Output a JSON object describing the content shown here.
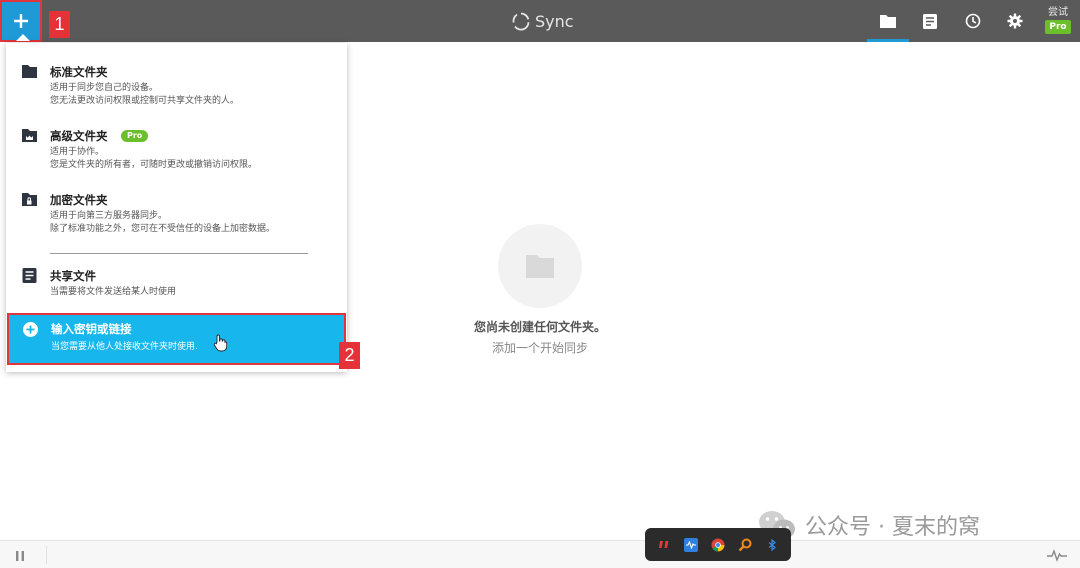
{
  "topbar": {
    "add_callout": "1",
    "brand": "Sync",
    "tools": [
      {
        "icon": "folder-icon",
        "active": true
      },
      {
        "icon": "document-icon",
        "active": false
      },
      {
        "icon": "history-icon",
        "active": false
      },
      {
        "icon": "gear-icon",
        "active": false
      }
    ],
    "try_label": "尝试",
    "pro_label": "Pro"
  },
  "menu": {
    "items": [
      {
        "icon": "folder-icon",
        "title": "标准文件夹",
        "desc1": "适用于同步您自己的设备。",
        "desc2": "您无法更改访问权限或控制可共享文件夹的人。"
      },
      {
        "icon": "advanced-folder-icon",
        "title": "高级文件夹",
        "badge": "Pro",
        "desc1": "适用于协作。",
        "desc2": "您是文件夹的所有者，可随时更改或撤销访问权限。"
      },
      {
        "icon": "encrypted-folder-icon",
        "title": "加密文件夹",
        "desc1": "适用于向第三方服务器同步。",
        "desc2": "除了标准功能之外，您可在不受信任的设备上加密数据。"
      },
      {
        "icon": "share-file-icon",
        "title": "共享文件",
        "desc1": "当需要将文件发送给某人时使用"
      },
      {
        "icon": "add-circle-icon",
        "title": "输入密钥或链接",
        "desc1": "当您需要从他人处接收文件夹时使用."
      }
    ],
    "highlight_callout": "2"
  },
  "empty_state": {
    "icon": "folder-icon",
    "title": "您尚未创建任何文件夹。",
    "subtitle": "添加一个开始同步"
  },
  "statusbar": {
    "left_icon": "pause-icon",
    "right_icon": "activity-icon"
  },
  "tray": {
    "icons": [
      "quote-app-icon",
      "sound-app-icon",
      "chrome-icon",
      "search-app-icon",
      "bluetooth-icon"
    ]
  },
  "watermark": {
    "text": "公众号 · 夏末的窝"
  },
  "colors": {
    "topbar_bg": "#5a5a5a",
    "accent_blue": "#1f9ad6",
    "highlight_bg": "#17b7ee",
    "pro_green": "#6bbf2d",
    "callout_red": "#e53238"
  }
}
